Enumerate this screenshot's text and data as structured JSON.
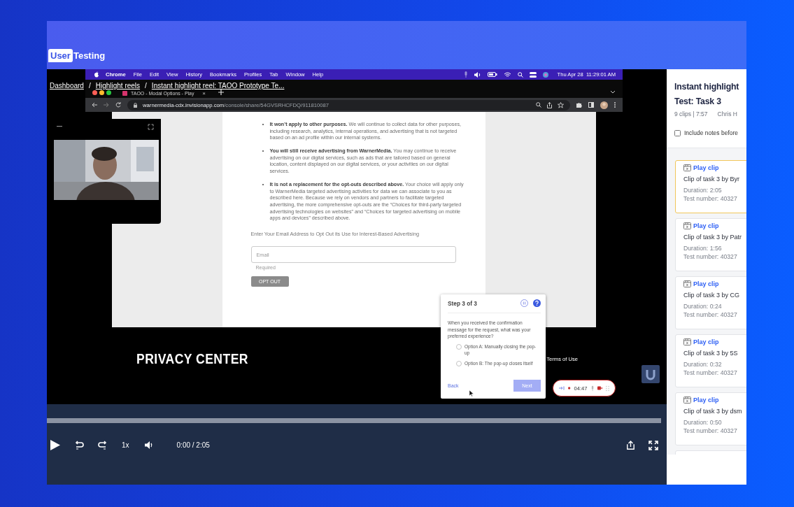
{
  "logo": {
    "part_1": "User",
    "part_2": "Testing"
  },
  "breadcrumb": {
    "separator": "/",
    "items": [
      "Dashboard",
      "Highlight reels",
      "Instant highlight reel: TAOO Prototype Te..."
    ]
  },
  "recording": {
    "menubar": {
      "app": "Chrome",
      "menus": [
        "File",
        "Edit",
        "View",
        "History",
        "Bookmarks",
        "Profiles",
        "Tab",
        "Window",
        "Help"
      ],
      "clock": "Thu Apr 28  11:29:01 AM"
    },
    "tab": {
      "title": "TAOO - Modal Options - Play",
      "close": "×"
    },
    "address": {
      "domain": "warnermedia-cdx.invisionapp.com",
      "path": "/console/share/54GVSRHCFDQ/911810087"
    },
    "document": {
      "bullets": [
        "**It won’t apply to other purposes.** We will continue to collect data for other purposes, including research, analytics, internal operations, and advertising that is not targeted based on an ad profile within our internal systems.",
        "**You will still receive advertising from WarnerMedia.** You may continue to receive advertising on our digital services, such as ads that are tailored based on general location, content displayed on our digital services, or your activities on our digital services.",
        "**It is not a replacement for the opt-outs described above.** Your choice will apply only to WarnerMedia targeted advertising activities for data we can associate to you as described here. Because we rely on vendors and partners to facilitate targeted advertising, the more comprehensive opt-outs are the “Choices for third-party targeted advertising technologies on websites” and “Choices for targeted advertising on mobile apps and devices” described above."
      ],
      "email_label": "Enter Your Email Address to Opt Out its Use for Interest-Based Advertising",
      "email_placeholder": "Email",
      "hint": "Required",
      "submit": "OPT OUT"
    },
    "footer": {
      "brand": "PRIVACY CENTER",
      "link": "Terms of Use"
    },
    "step_dialog": {
      "title": "Step 3 of 3",
      "question": "When you received the confirmation message for the request, what was your preferred experience?",
      "options": [
        {
          "label": "Option A: Manually closing the pop-up",
          "selected": false
        },
        {
          "label": "Option B: The pop-up closes itself",
          "selected": false
        }
      ],
      "back": "Back",
      "next": "Next"
    },
    "recorder": {
      "time": "04:47"
    }
  },
  "player": {
    "level": 0,
    "speed": "1x",
    "time": "0:00 / 2:05"
  },
  "panel": {
    "title": "Instant highlight",
    "subtitle": "Test: Task 3",
    "count": "9 clips | 7:57",
    "author": "Chris H",
    "include_notes": {
      "label": "Include notes before",
      "checked": false
    },
    "clips": [
      {
        "action": "Play clip",
        "title": "Clip of task 3 by Byr",
        "duration": "Duration: 2:05",
        "test_number": "Test number: 40327",
        "selected": true
      },
      {
        "action": "Play clip",
        "title": "Clip of task 3 by Patr",
        "duration": "Duration: 1:56",
        "test_number": "Test number: 40327",
        "selected": false
      },
      {
        "action": "Play clip",
        "title": "Clip of task 3 by CG",
        "duration": "Duration: 0:24",
        "test_number": "Test number: 40327",
        "selected": false
      },
      {
        "action": "Play clip",
        "title": "Clip of task 3 by 5S",
        "duration": "Duration: 0:32",
        "test_number": "Test number: 40327",
        "selected": false
      },
      {
        "action": "Play clip",
        "title": "Clip of task 3 by dsm",
        "duration": "Duration: 0:50",
        "test_number": "Test number: 40327",
        "selected": false
      }
    ]
  }
}
